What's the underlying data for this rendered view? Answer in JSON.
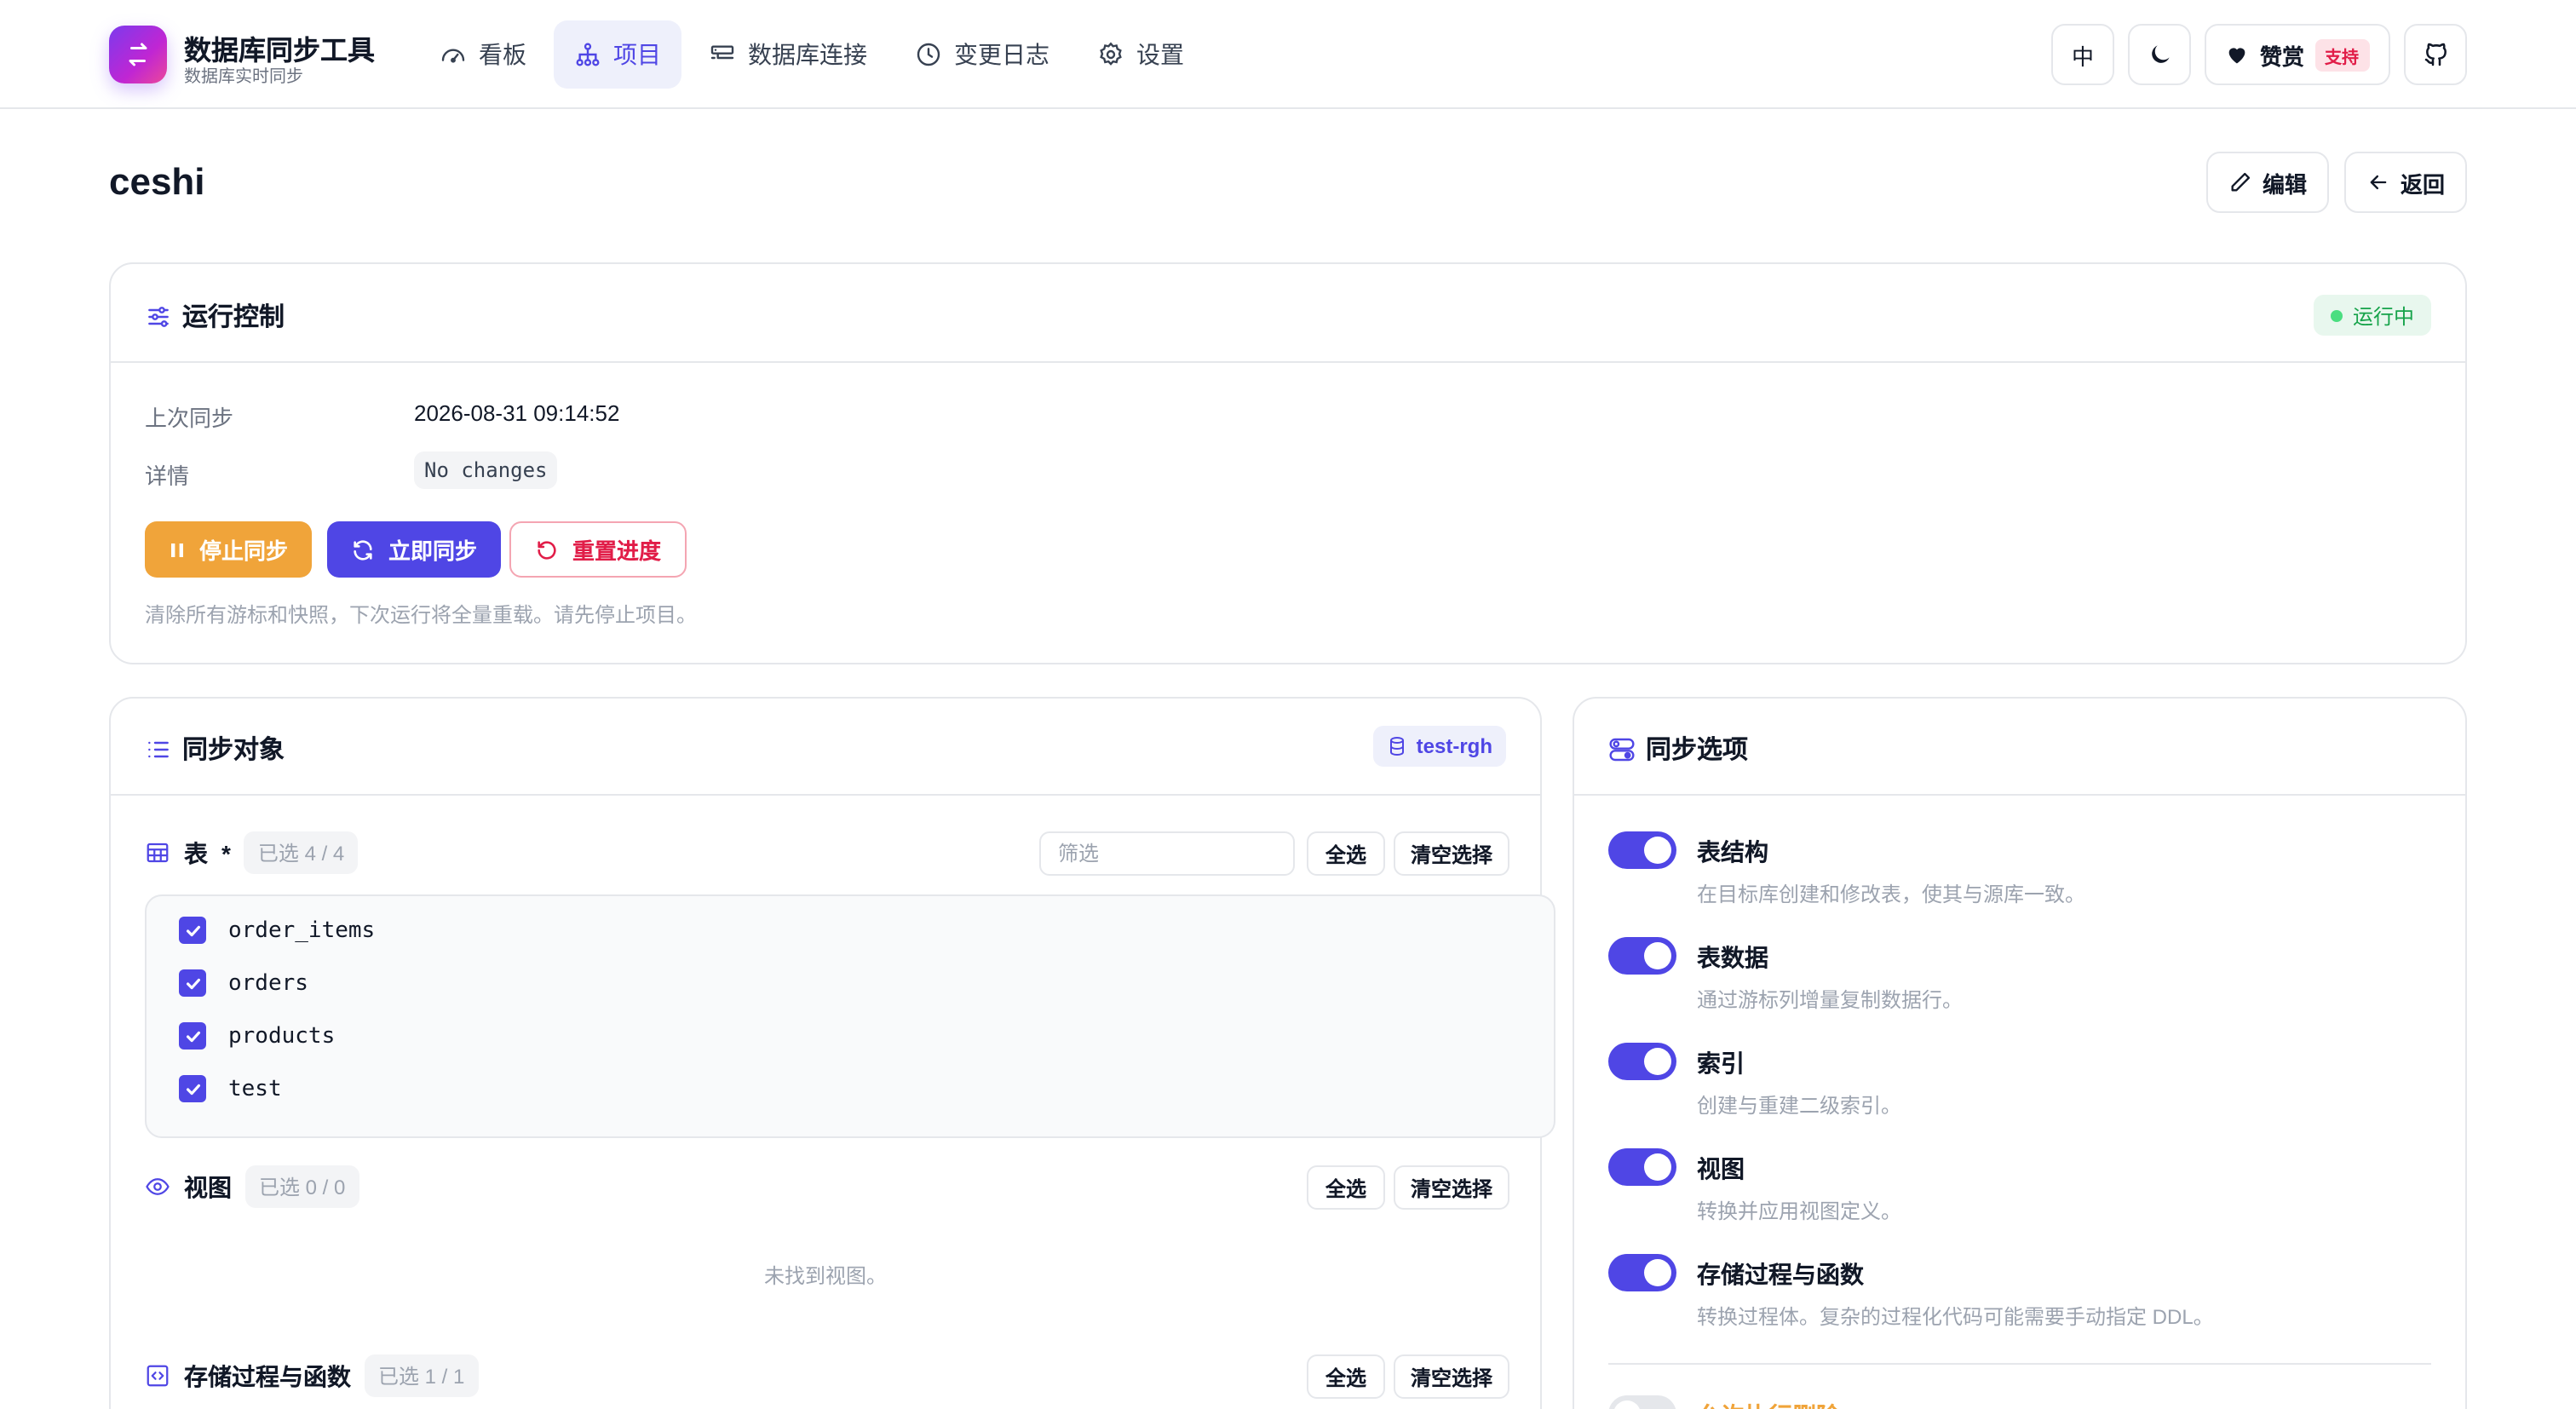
{
  "header": {
    "brand_title": "数据库同步工具",
    "brand_subtitle": "数据库实时同步",
    "nav": [
      {
        "label": "看板",
        "icon": "gauge-icon",
        "active": false
      },
      {
        "label": "项目",
        "icon": "hierarchy-icon",
        "active": true
      },
      {
        "label": "数据库连接",
        "icon": "server-connection-icon",
        "active": false
      },
      {
        "label": "变更日志",
        "icon": "clock-icon",
        "active": false
      },
      {
        "label": "设置",
        "icon": "gear-icon",
        "active": false
      }
    ],
    "lang_label": "中",
    "support_label": "赞赏",
    "support_badge": "支持"
  },
  "page": {
    "title": "ceshi",
    "edit_label": "编辑",
    "back_label": "返回"
  },
  "run_control": {
    "title": "运行控制",
    "status": "运行中",
    "last_sync_label": "上次同步",
    "last_sync_value": "2026-08-31 09:14:52",
    "details_label": "详情",
    "details_value": "No changes",
    "stop_label": "停止同步",
    "sync_now_label": "立即同步",
    "reset_label": "重置进度",
    "hint": "清除所有游标和快照，下次运行将全量重载。请先停止项目。"
  },
  "sync_objects": {
    "title": "同步对象",
    "database": "test-rgh",
    "tables": {
      "label": "表",
      "required_mark": "*",
      "selected": "已选 4 / 4",
      "filter_placeholder": "筛选",
      "select_all": "全选",
      "clear": "清空选择",
      "items": [
        "order_items",
        "orders",
        "products",
        "test"
      ]
    },
    "views": {
      "label": "视图",
      "selected": "已选 0 / 0",
      "select_all": "全选",
      "clear": "清空选择",
      "empty": "未找到视图。"
    },
    "routines": {
      "label": "存储过程与函数",
      "selected": "已选 1 / 1",
      "select_all": "全选",
      "clear": "清空选择"
    }
  },
  "sync_options": {
    "title": "同步选项",
    "items": [
      {
        "title": "表结构",
        "desc": "在目标库创建和修改表，使其与源库一致。",
        "on": true
      },
      {
        "title": "表数据",
        "desc": "通过游标列增量复制数据行。",
        "on": true
      },
      {
        "title": "索引",
        "desc": "创建与重建二级索引。",
        "on": true
      },
      {
        "title": "视图",
        "desc": "转换并应用视图定义。",
        "on": true
      },
      {
        "title": "存储过程与函数",
        "desc": "转换过程体。复杂的过程化代码可能需要手动指定 DDL。",
        "on": true
      }
    ],
    "partial_item": {
      "title": "允许执行删除",
      "on": false
    }
  },
  "colors": {
    "accent": "#4f46e5",
    "warning": "#f0a43a",
    "danger": "#e11d48",
    "success": "#16a34a"
  }
}
